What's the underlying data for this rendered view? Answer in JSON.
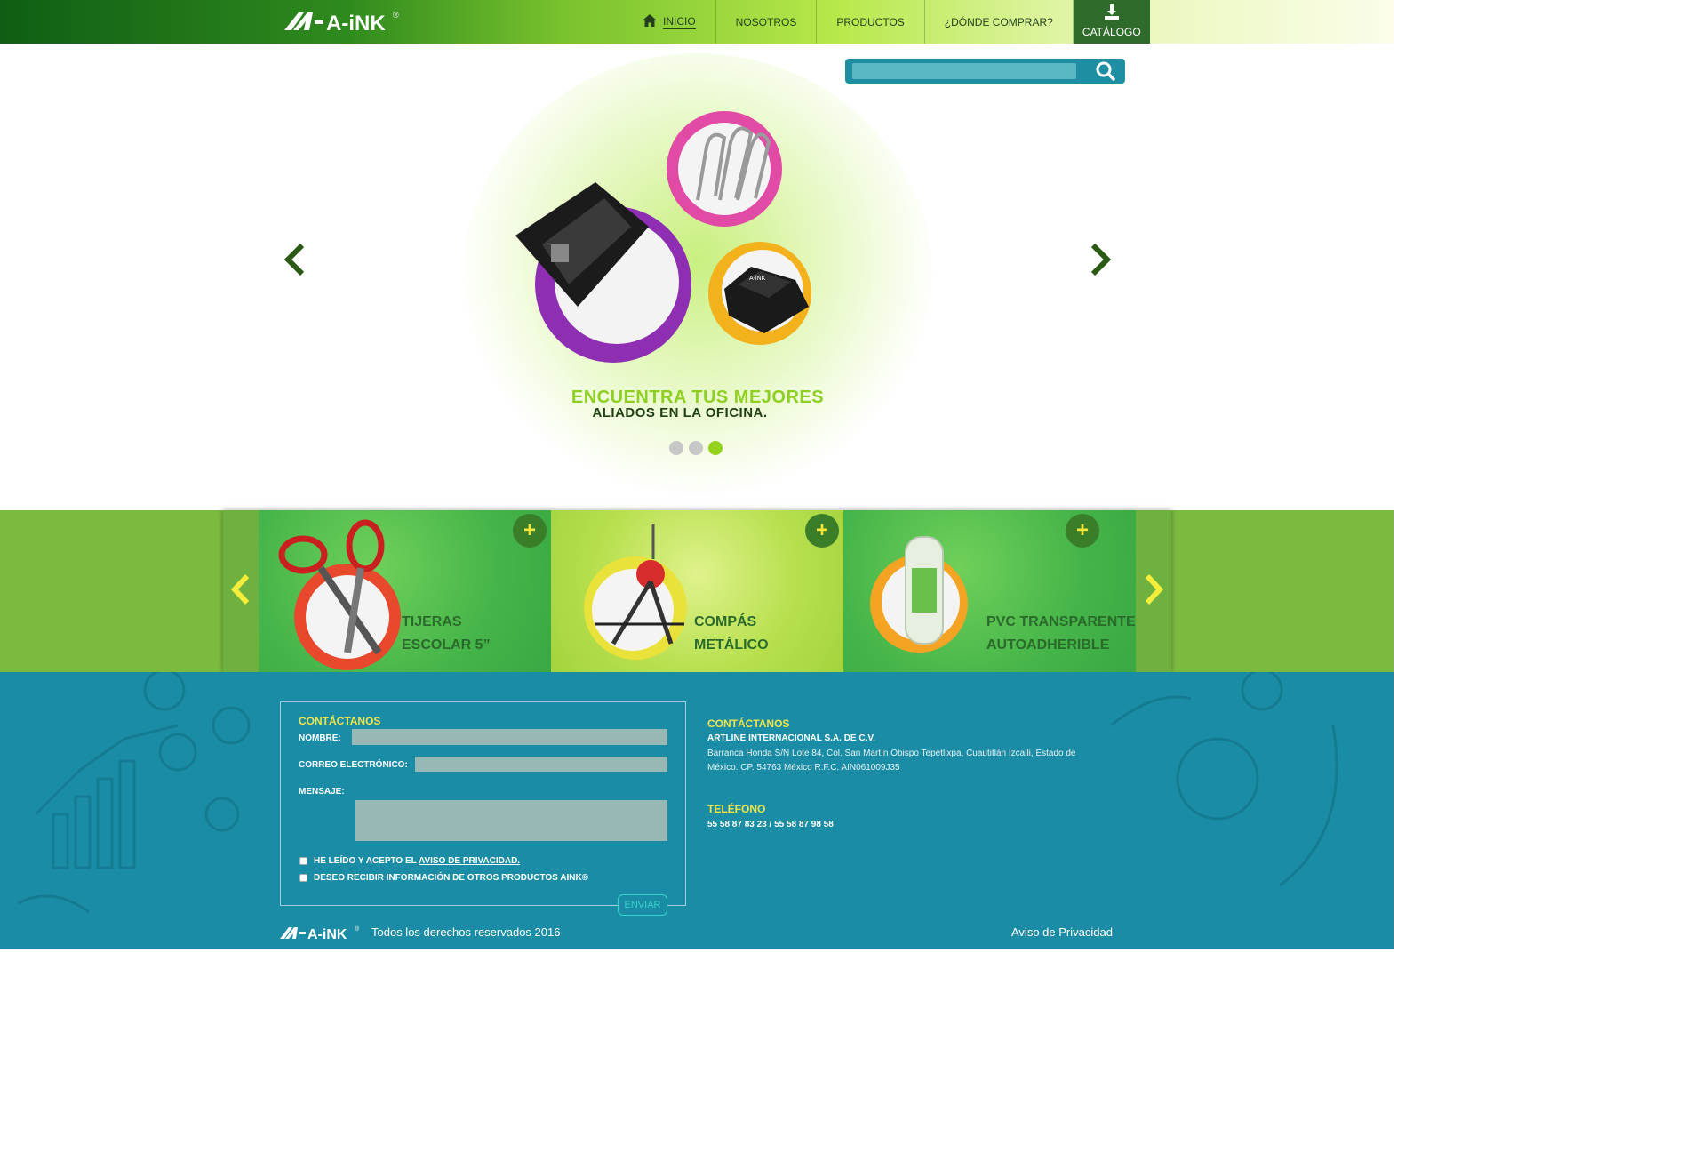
{
  "brand": {
    "logo_text": "A-iNK",
    "registered": "®"
  },
  "nav": {
    "items": [
      {
        "label": "INICIO",
        "icon": "home-icon",
        "active": true
      },
      {
        "label": "NOSOTROS"
      },
      {
        "label": "PRODUCTOS"
      },
      {
        "label": "¿DÓNDE COMPRAR?"
      }
    ],
    "catalog": {
      "label": "CATÁLOGO",
      "icon": "download-icon"
    }
  },
  "search": {
    "placeholder": "",
    "value": "",
    "icon": "search-icon"
  },
  "hero": {
    "line1": "ENCUENTRA TUS MEJORES",
    "line2": "ALIADOS EN LA OFICINA.",
    "slides_total": 3,
    "active_slide": 3
  },
  "products": [
    {
      "title_line1": "TIJERAS",
      "title_line2": "ESCOLAR 5”",
      "plus": "+"
    },
    {
      "title_line1": "COMPÁS",
      "title_line2": "METÁLICO",
      "plus": "+"
    },
    {
      "title_line1": "PVC TRANSPARENTE",
      "title_line2": "AUTOADHERIBLE",
      "plus": "+"
    }
  ],
  "form": {
    "title": "CONTÁCTANOS",
    "name_label": "NOMBRE:",
    "email_label": "CORREO ELECTRÓNICO:",
    "message_label": "MENSAJE:",
    "privacy_check_prefix": "HE LEÍDO Y ACEPTO EL ",
    "privacy_check_link": "AVISO DE PRIVACIDAD.",
    "newsletter_check": "DESEO RECIBIR INFORMACIÓN DE OTROS PRODUCTOS AINK®",
    "send": "ENVIAR"
  },
  "contact": {
    "title": "CONTÁCTANOS",
    "company": "ARTLINE INTERNACIONAL S.A. DE C.V.",
    "address": "Barranca Honda S/N Lote 84, Col. San Martín Obispo Tepetlixpa, Cuautitlán Izcalli, Estado de México. CP. 54763 México R.F.C. AIN061009J35",
    "phone_title": "TELÉFONO",
    "phones": "55 58 87 83 23 / 55 58 87 98 58"
  },
  "footer": {
    "copyright": "Todos los derechos reservados 2016",
    "privacy": "Aviso de Privacidad"
  },
  "colors": {
    "header_dark": "#0f5e14",
    "accent_green": "#95d21b",
    "footer_blue": "#1a8ca5",
    "footer_yellow": "#f0e449"
  }
}
